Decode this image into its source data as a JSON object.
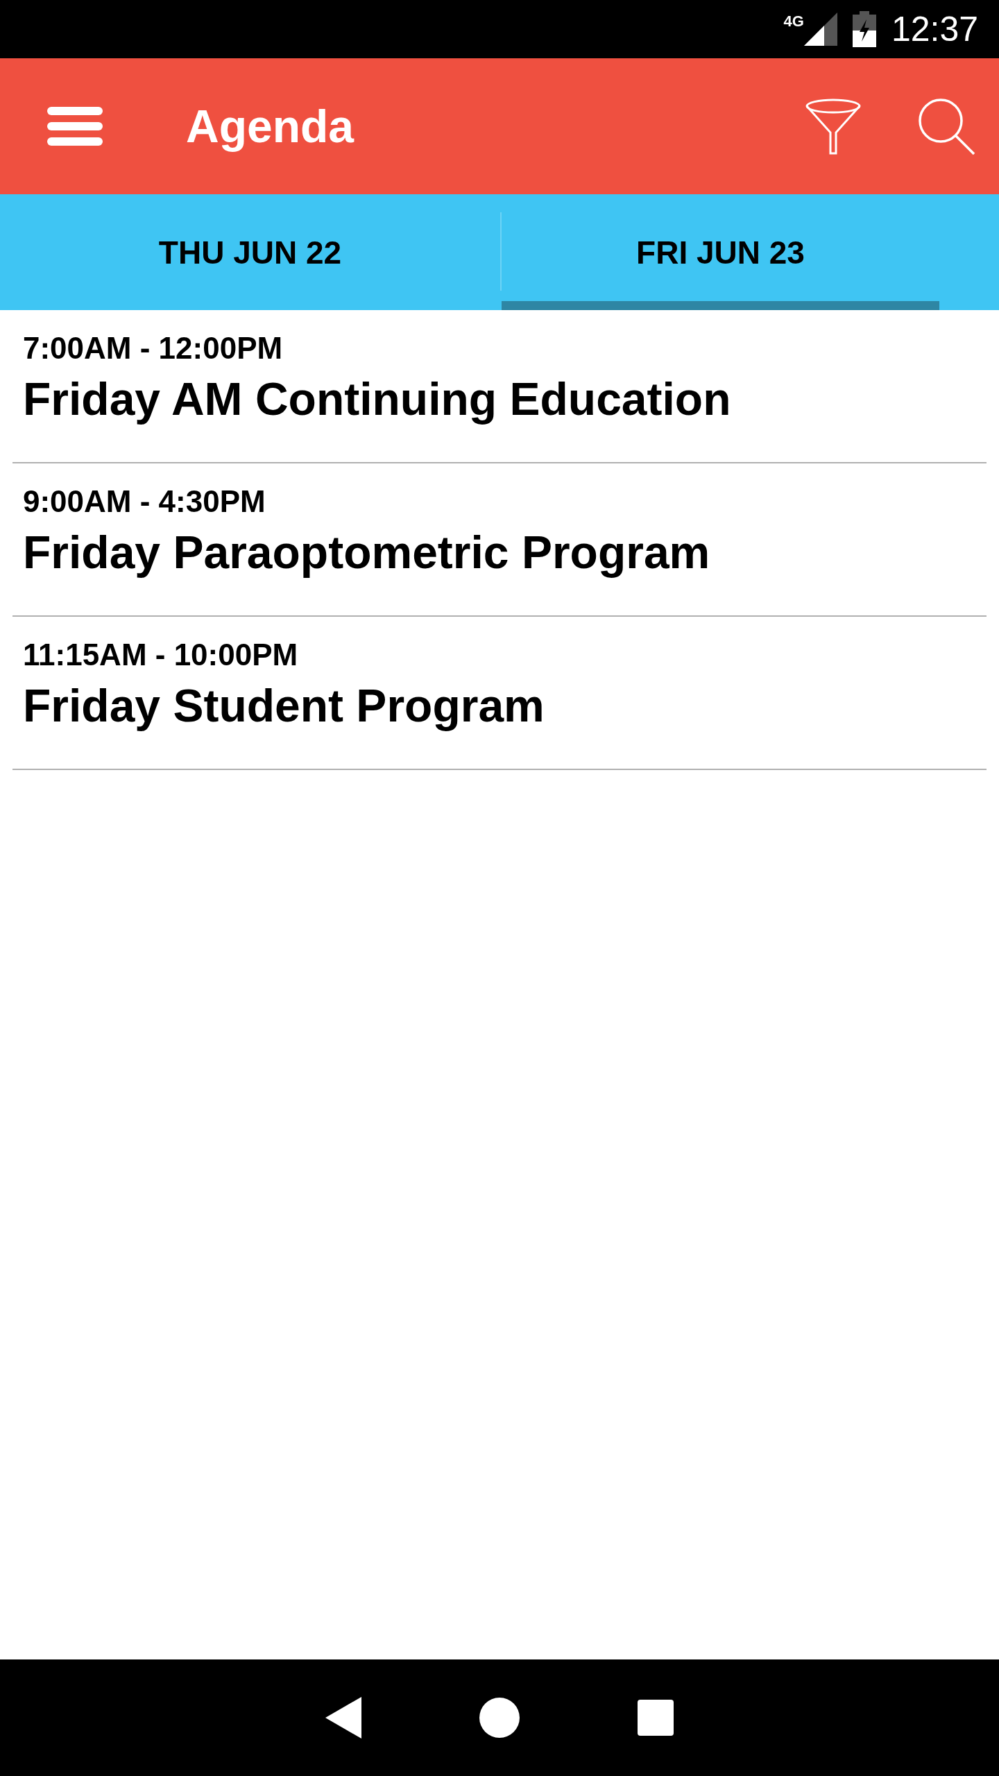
{
  "status_bar": {
    "network": "4G",
    "time": "12:37"
  },
  "app_bar": {
    "title": "Agenda"
  },
  "tabs": [
    {
      "label": "THU JUN 22",
      "selected": false
    },
    {
      "label": "FRI JUN 23",
      "selected": true
    }
  ],
  "sessions": [
    {
      "time": "7:00AM - 12:00PM",
      "title": "Friday AM Continuing Education"
    },
    {
      "time": "9:00AM - 4:30PM",
      "title": "Friday Paraoptometric Program"
    },
    {
      "time": "11:15AM - 10:00PM",
      "title": "Friday Student Program"
    }
  ]
}
